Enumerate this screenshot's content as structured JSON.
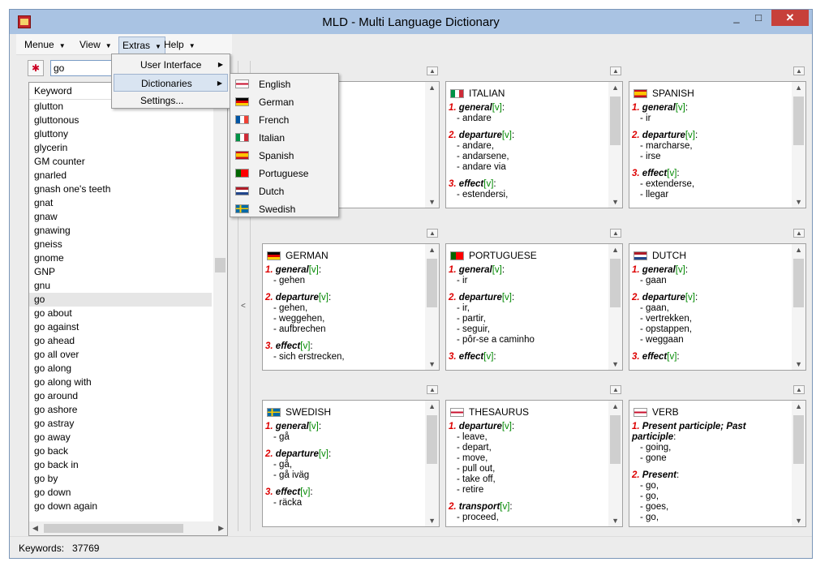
{
  "window": {
    "title": "MLD - Multi Language Dictionary",
    "min": "_",
    "max": "□",
    "close": "✕"
  },
  "menubar": {
    "menue": "Menue",
    "view": "View",
    "extras": "Extras",
    "help": "Help"
  },
  "search": {
    "value": "go",
    "icon": "search-flag-icon"
  },
  "keywords": {
    "header": "Keyword",
    "items": [
      "glutton",
      "gluttonous",
      "gluttony",
      "glycerin",
      "GM counter",
      "gnarled",
      "gnash one's teeth",
      "gnat",
      "gnaw",
      "gnawing",
      "gneiss",
      "gnome",
      "GNP",
      "gnu",
      "go",
      "go about",
      "go against",
      "go ahead",
      "go all over",
      "go along",
      "go along with",
      "go around",
      "go ashore",
      "go astray",
      "go away",
      "go back",
      "go back in",
      "go by",
      "go down",
      "go down again"
    ],
    "selected": "go"
  },
  "extras_menu": {
    "items": [
      "User Interface",
      "Dictionaries",
      "Settings..."
    ]
  },
  "dictionaries_menu": {
    "items": [
      "English",
      "German",
      "French",
      "Italian",
      "Spanish",
      "Portuguese",
      "Dutch",
      "Swedish"
    ]
  },
  "panels": [
    {
      "title": "",
      "senses": []
    },
    {
      "title": "ITALIAN",
      "flag": "italy",
      "senses": [
        {
          "n": "1.",
          "w": "general",
          "p": "[v]",
          "t": [
            "andare"
          ]
        },
        {
          "n": "2.",
          "w": "departure",
          "p": "[v]",
          "t": [
            "andare,",
            "andarsene,",
            "andare via"
          ]
        },
        {
          "n": "3.",
          "w": "effect",
          "p": "[v]",
          "t": [
            "estendersi,"
          ]
        }
      ]
    },
    {
      "title": "SPANISH",
      "flag": "spain",
      "senses": [
        {
          "n": "1.",
          "w": "general",
          "p": "[v]",
          "t": [
            "ir"
          ]
        },
        {
          "n": "2.",
          "w": "departure",
          "p": "[v]",
          "t": [
            "marcharse,",
            "irse"
          ]
        },
        {
          "n": "3.",
          "w": "effect",
          "p": "[v]",
          "t": [
            "extenderse,",
            "llegar"
          ]
        }
      ]
    },
    {
      "title": "GERMAN",
      "flag": "germany",
      "senses": [
        {
          "n": "1.",
          "w": "general",
          "p": "[v]",
          "t": [
            "gehen"
          ]
        },
        {
          "n": "2.",
          "w": "departure",
          "p": "[v]",
          "t": [
            "gehen,",
            "weggehen,",
            "aufbrechen"
          ]
        },
        {
          "n": "3.",
          "w": "effect",
          "p": "[v]",
          "t": [
            "sich erstrecken,"
          ]
        }
      ]
    },
    {
      "title": "PORTUGUESE",
      "flag": "portugal",
      "senses": [
        {
          "n": "1.",
          "w": "general",
          "p": "[v]",
          "t": [
            "ir"
          ]
        },
        {
          "n": "2.",
          "w": "departure",
          "p": "[v]",
          "t": [
            "ir,",
            "partir,",
            "seguir,",
            "pôr-se a caminho"
          ]
        },
        {
          "n": "3.",
          "w": "effect",
          "p": "[v]",
          "t": []
        }
      ]
    },
    {
      "title": "DUTCH",
      "flag": "netherlands",
      "senses": [
        {
          "n": "1.",
          "w": "general",
          "p": "[v]",
          "t": [
            "gaan"
          ]
        },
        {
          "n": "2.",
          "w": "departure",
          "p": "[v]",
          "t": [
            "gaan,",
            "vertrekken,",
            "opstappen,",
            "weggaan"
          ]
        },
        {
          "n": "3.",
          "w": "effect",
          "p": "[v]",
          "t": []
        }
      ]
    },
    {
      "title": "SWEDISH",
      "flag": "sweden",
      "senses": [
        {
          "n": "1.",
          "w": "general",
          "p": "[v]",
          "t": [
            "gå"
          ]
        },
        {
          "n": "2.",
          "w": "departure",
          "p": "[v]",
          "t": [
            "gå,",
            "gå iväg"
          ]
        },
        {
          "n": "3.",
          "w": "effect",
          "p": "[v]",
          "t": [
            "räcka"
          ]
        }
      ]
    },
    {
      "title": "THESAURUS",
      "flag": "uk",
      "senses": [
        {
          "n": "1.",
          "w": "departure",
          "p": "[v]",
          "t": [
            "leave,",
            "depart,",
            "move,",
            "pull out,",
            "take off,",
            "retire"
          ]
        },
        {
          "n": "2.",
          "w": "transport",
          "p": "[v]",
          "t": [
            "proceed,"
          ]
        }
      ]
    },
    {
      "title": "VERB",
      "flag": "uk",
      "senses": [
        {
          "n": "1.",
          "w": "Present participle; Past participle",
          "p": ":",
          "t": [
            "going,",
            "gone"
          ]
        },
        {
          "n": "2.",
          "w": "Present",
          "p": ":",
          "t": [
            "go,",
            "go,",
            "goes,",
            "go,"
          ]
        }
      ]
    }
  ],
  "status": {
    "label": "Keywords:",
    "count": "37769"
  }
}
